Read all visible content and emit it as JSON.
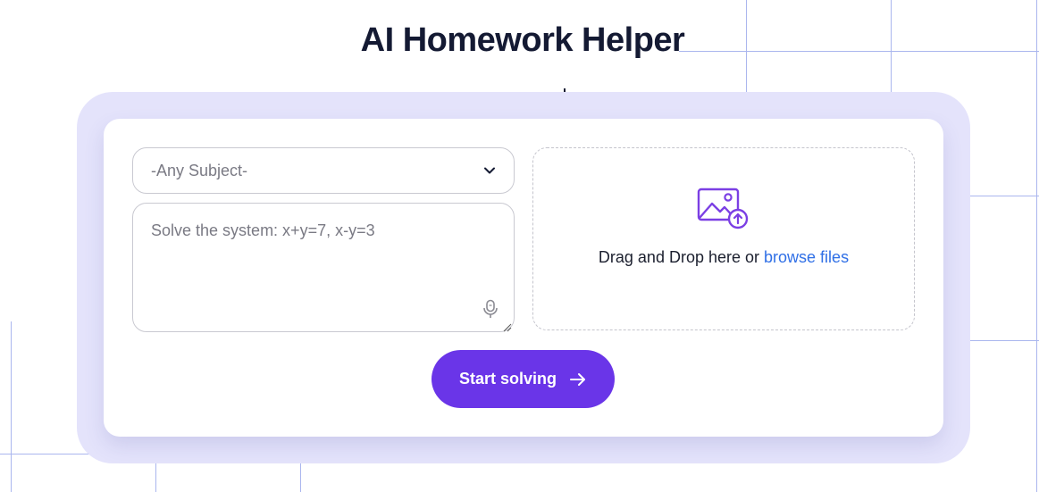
{
  "page": {
    "title": "AI Homework Helper"
  },
  "form": {
    "subject_select": {
      "selected": "-Any Subject-",
      "icon": "chevron-down-icon"
    },
    "question_input": {
      "placeholder": "Solve the system: x+y=7, x-y=3",
      "icon": "microphone-icon"
    },
    "dropzone": {
      "icon": "image-upload-icon",
      "text": "Drag and Drop here or",
      "link_text": "browse files"
    },
    "submit": {
      "label": "Start solving",
      "icon": "arrow-right-icon"
    }
  },
  "colors": {
    "accent": "#6a35e8",
    "link": "#2f6fe6",
    "frame": "#e4e3fb",
    "icon_purple": "#7b3fe4"
  }
}
